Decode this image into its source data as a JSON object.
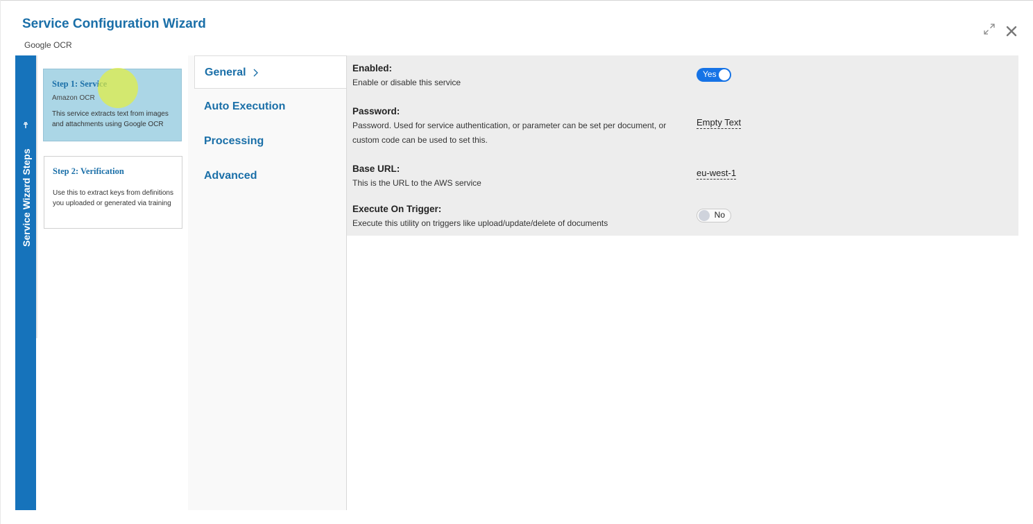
{
  "dialog": {
    "title": "Service Configuration Wizard",
    "subtitle": "Google OCR",
    "expand_icon": "expand-icon",
    "close_icon": "close-icon"
  },
  "steps_bar": {
    "label": "Service Wizard Steps",
    "pin_icon": "pin-icon"
  },
  "steps": [
    {
      "title": "Step 1: Service",
      "subtitle": "Amazon OCR",
      "description": "This service extracts text from images and attachments using Google OCR",
      "active": true
    },
    {
      "title": "Step 2: Verification",
      "description": "Use this to extract keys from definitions you uploaded or generated via training",
      "active": false
    }
  ],
  "tabs": [
    {
      "label": "General",
      "selected": true
    },
    {
      "label": "Auto Execution",
      "selected": false
    },
    {
      "label": "Processing",
      "selected": false
    },
    {
      "label": "Advanced",
      "selected": false
    }
  ],
  "settings": {
    "enabled": {
      "label": "Enabled:",
      "description": "Enable or disable this service",
      "value": "Yes",
      "on": true
    },
    "password": {
      "label": "Password:",
      "description": "Password. Used for service authentication, or parameter can be set per document, or custom code can be used to set this.",
      "value": "Empty Text"
    },
    "base_url": {
      "label": "Base URL:",
      "description": "This is the URL to the AWS service",
      "value": "eu-west-1"
    },
    "execute_on_trigger": {
      "label": "Execute On Trigger:",
      "description": "Execute this utility on triggers like upload/update/delete of documents",
      "value": "No",
      "on": false
    }
  },
  "colors": {
    "accent": "#1a6fa8",
    "bar": "#1673bb",
    "toggle_on": "#1673e6",
    "active_step": "#abd6e6"
  }
}
